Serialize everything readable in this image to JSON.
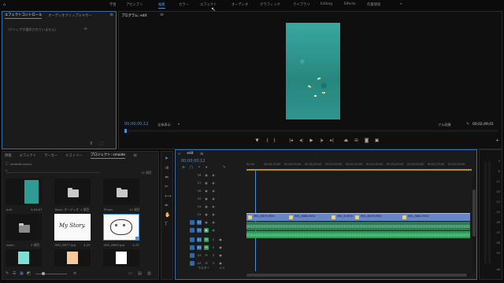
{
  "topbar": {
    "workspaces": [
      "学習",
      "アセンブリ",
      "編集",
      "カラー",
      "エフェクト",
      "オーディオ",
      "グラフィック",
      "ライブラリ",
      "Editing",
      "Effects",
      "作業環境"
    ],
    "active_index": 2,
    "more": "»"
  },
  "source_panel": {
    "tabs": [
      "エフェクトコントロール",
      "オーディオクリップミキサー"
    ],
    "active_tab": 0,
    "message": "（クリップが選択されていません）"
  },
  "program_monitor": {
    "tab": "プログラム: edit",
    "timecode": "00;00;00;12",
    "zoom": "全体表示",
    "quality": "フル画質",
    "duration": "00;02;49;01",
    "accent": "#4d8fd6",
    "video_color": "#2f9b94"
  },
  "project_panel": {
    "tabs": [
      "情報",
      "エフェクト",
      "マーカー",
      "ヒストリー",
      "プロジェクト: smoide"
    ],
    "active_tab": 4,
    "path": "smoide.prproj",
    "item_count": "11 項目",
    "items": [
      {
        "name": "edit",
        "meta": "3;09;07",
        "kind": "sequence"
      },
      {
        "name": "Basic オーディオ",
        "meta": "1 項目",
        "kind": "folder"
      },
      {
        "name": "Photo",
        "meta": "11 項目",
        "kind": "folder"
      },
      {
        "name": "sozai",
        "meta": "4 項目",
        "kind": "folder"
      },
      {
        "name": "IMG_8877.jpg",
        "meta": "4;29",
        "kind": "handwriting",
        "text": "My Story."
      },
      {
        "name": "IMG_8883.jpg",
        "meta": "4;29",
        "kind": "sketch"
      },
      {
        "name": "",
        "meta": "",
        "kind": "cyan"
      },
      {
        "name": "",
        "meta": "",
        "kind": "peach"
      },
      {
        "name": "",
        "meta": "",
        "kind": "white"
      }
    ]
  },
  "timeline": {
    "tab": "edit",
    "timecode": "00;00;00;12",
    "ruler": [
      "00;00",
      "00;00;15;00",
      "00;00;30;00",
      "00;00;45;00",
      "00;01;00;00",
      "00;01;15;00",
      "00;01;30;00",
      "00;01;45;00",
      "00;02;00;00",
      "00;02;15;00",
      "00;02;30;00"
    ],
    "video_tracks": [
      "V8",
      "V7",
      "V6",
      "V5",
      "V4",
      "V3",
      "V2",
      "V1"
    ],
    "audio_tracks": [
      "A1",
      "A2",
      "A3",
      "A4"
    ],
    "master_label": "マスター",
    "master_value": "0.0",
    "clips": [
      "IMG_8875.MOV",
      "IMG_8880.MOV",
      "IMG_8.MOV",
      "IMG_8878.MOV",
      "IMG_8881.MOV"
    ],
    "clip_color": "#6a84c4",
    "audio_color": "#2f9a5c"
  },
  "audio_meter": {
    "labels": [
      "0",
      "-6",
      "-12",
      "-18",
      "-24",
      "-30",
      "-36",
      "-42",
      "-48",
      "-54",
      "dB"
    ]
  }
}
